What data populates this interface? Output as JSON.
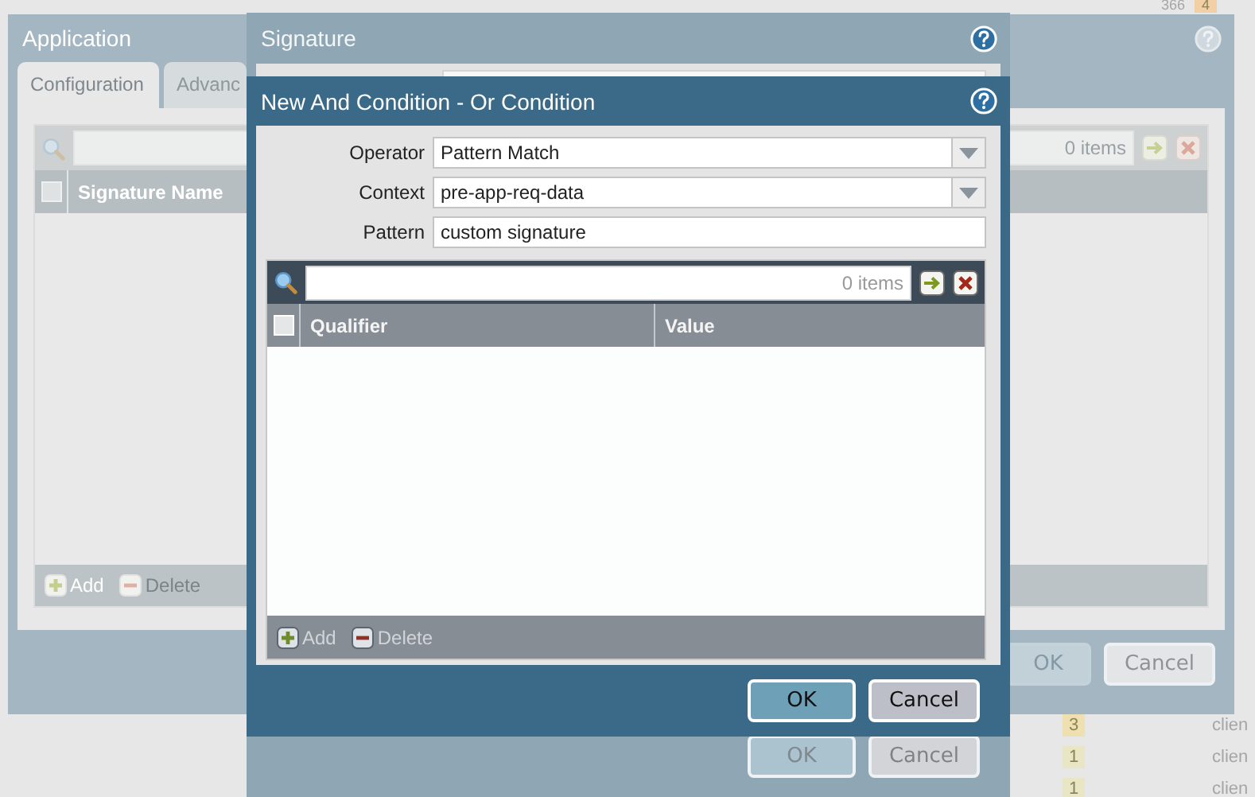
{
  "background": {
    "counter": "366",
    "badge": "4",
    "rows": [
      {
        "badge": "3",
        "text": "clien"
      },
      {
        "badge": "1",
        "text": "clien"
      },
      {
        "badge": "1",
        "text": "clien"
      }
    ]
  },
  "application": {
    "title": "Application",
    "tabs": [
      {
        "label": "Configuration",
        "selected": true
      },
      {
        "label": "Advanc",
        "selected": false
      }
    ],
    "count": "0 items",
    "select_all": {
      "checked": false
    },
    "columns": [
      "Signature Name"
    ],
    "footer": [
      {
        "label": "Add",
        "kind": "add",
        "disabled": false
      },
      {
        "label": "Delete",
        "kind": "delete",
        "disabled": true
      }
    ],
    "buttons": [
      {
        "label": "OK",
        "disabled": true
      },
      {
        "label": "Cancel",
        "disabled": false
      }
    ]
  },
  "signature": {
    "title": "Signature",
    "buttons": [
      {
        "label": "OK",
        "kind": "primary"
      },
      {
        "label": "Cancel",
        "kind": "secondary"
      }
    ]
  },
  "condition": {
    "title": "New And Condition - Or Condition",
    "fields": [
      {
        "label": "Operator",
        "value": "Pattern Match",
        "kind": "select"
      },
      {
        "label": "Context",
        "value": "pre-app-req-data",
        "kind": "select"
      },
      {
        "label": "Pattern",
        "value": "custom signature",
        "kind": "text"
      }
    ],
    "count": "0 items",
    "select_all": {
      "checked": false
    },
    "columns": [
      "Qualifier",
      "Value"
    ],
    "footer": [
      {
        "label": "Add",
        "kind": "add",
        "disabled": true
      },
      {
        "label": "Delete",
        "kind": "delete",
        "disabled": true
      }
    ],
    "buttons": [
      {
        "label": "OK",
        "kind": "primary"
      },
      {
        "label": "Cancel",
        "kind": "secondary"
      }
    ]
  }
}
